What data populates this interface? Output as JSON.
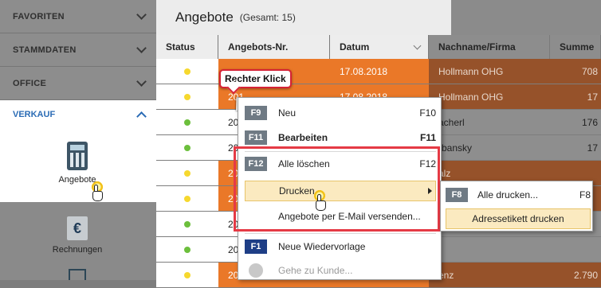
{
  "sidebar": {
    "sections": [
      "FAVORITEN",
      "STAMMDATEN",
      "OFFICE"
    ],
    "active_section": "VERKAUF",
    "modules": [
      {
        "label": "Angebote",
        "icon": "calculator-icon"
      },
      {
        "label": "Rechnungen",
        "icon": "invoice-euro-icon"
      }
    ]
  },
  "main": {
    "title": "Angebote",
    "total": "(Gesamt: 15)",
    "columns": [
      "Status",
      "Angebots-Nr.",
      "Datum",
      "Nachname/Firma",
      "Summe"
    ],
    "rows": [
      {
        "status": "yellow",
        "nr": "",
        "datum": "17.08.2018",
        "name": "Hollmann OHG",
        "summe": "708",
        "style": "orange"
      },
      {
        "status": "yellow",
        "nr": "201",
        "datum": "17.08.2018",
        "name": "Hollmann OHG",
        "summe": "17",
        "style": "orange"
      },
      {
        "status": "green",
        "nr": "201",
        "datum": "",
        "name": "acherl",
        "summe": "176",
        "style": "white"
      },
      {
        "status": "green",
        "nr": "201",
        "datum": "",
        "name": "rbansky",
        "summe": "17",
        "style": "white"
      },
      {
        "status": "yellow",
        "nr": "201",
        "datum": "",
        "name": "alz",
        "summe": "",
        "style": "orange"
      },
      {
        "status": "yellow",
        "nr": "201",
        "datum": "",
        "name": "",
        "summe": "",
        "style": "orange"
      },
      {
        "status": "green",
        "nr": "201",
        "datum": "",
        "name": "",
        "summe": "",
        "style": "white"
      },
      {
        "status": "green",
        "nr": "201",
        "datum": "",
        "name": "",
        "summe": "",
        "style": "white"
      },
      {
        "status": "yellow",
        "nr": "201",
        "datum": "",
        "name": "enz",
        "summe": "2.790",
        "style": "orange"
      }
    ]
  },
  "tooltip": "Rechter Klick",
  "context_menu": [
    {
      "key": "F9",
      "label": "Neu",
      "shortcut": "F10",
      "bold": false
    },
    {
      "key": "F11",
      "label": "Bearbeiten",
      "shortcut": "F11",
      "bold": true
    },
    {
      "key": "F12",
      "label": "Alle löschen",
      "shortcut": "F12",
      "bold": false
    },
    {
      "key": "",
      "label": "Drucken",
      "shortcut": "",
      "bold": false,
      "submenu": true
    },
    {
      "key": "",
      "label": "Angebote per E-Mail versenden...",
      "shortcut": "",
      "bold": false
    },
    {
      "key": "F1",
      "label": "Neue Wiedervorlage",
      "shortcut": "",
      "bold": false
    },
    {
      "key": "",
      "label": "Gehe zu Kunde...",
      "shortcut": "",
      "disabled": true
    }
  ],
  "submenu": [
    {
      "key": "F8",
      "label": "Alle drucken...",
      "shortcut": "F8"
    },
    {
      "key": "",
      "label": "Adressetikett drucken",
      "shortcut": ""
    }
  ],
  "colors": {
    "orange": "#ea7828",
    "highlight": "#fbeac0",
    "accent_blue": "#2b6cb5",
    "red_frame": "#e53a45"
  }
}
